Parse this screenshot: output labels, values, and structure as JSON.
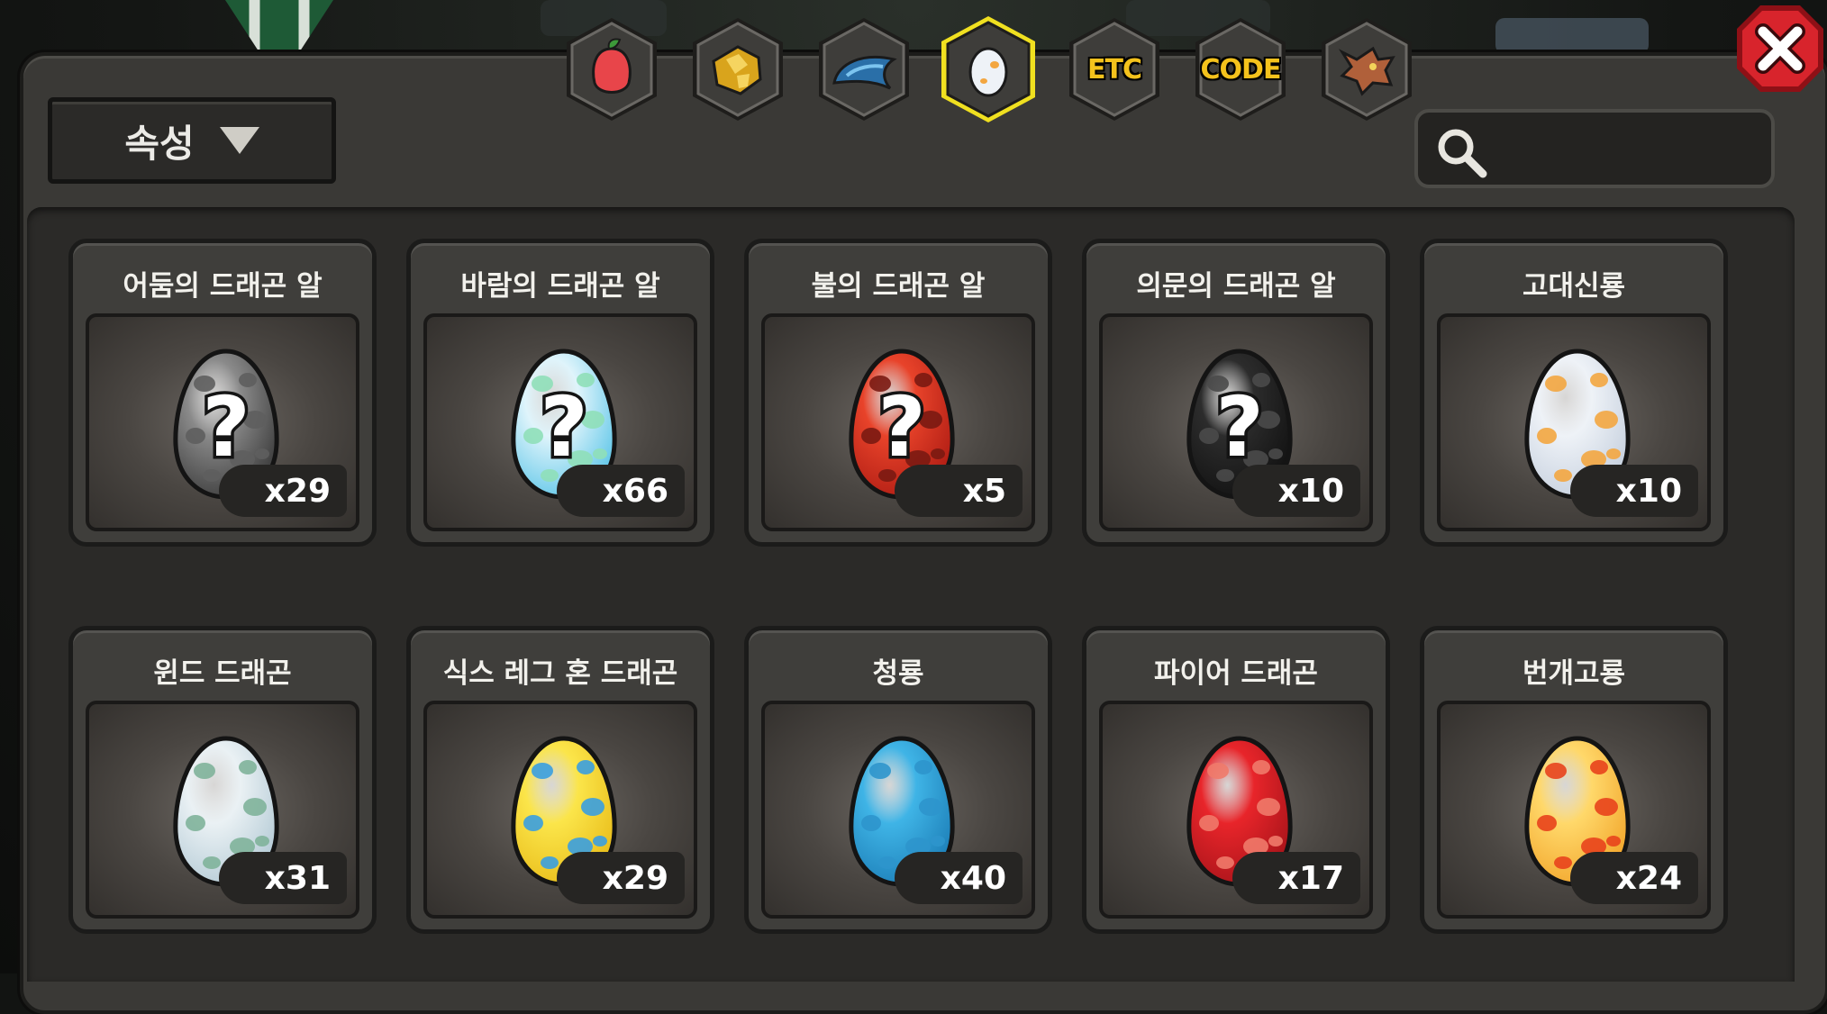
{
  "colors": {
    "panel": "#3a3936",
    "tab_selected_border": "#f0e020",
    "tab_text": "#f4c21c",
    "close_red": "#d8242c"
  },
  "filter": {
    "label": "속성"
  },
  "search": {
    "value": ""
  },
  "tabs": [
    {
      "icon": "fruit-icon",
      "selected": false
    },
    {
      "icon": "gold-ore-icon",
      "selected": false
    },
    {
      "icon": "dragon-scale-icon",
      "selected": false
    },
    {
      "icon": "egg-icon",
      "selected": true
    },
    {
      "label": "ETC",
      "selected": false
    },
    {
      "label": "CODE",
      "selected": false
    },
    {
      "icon": "dragon-head-icon",
      "selected": false
    }
  ],
  "items": [
    {
      "name": "어둠의 드래곤 알",
      "count": "x29",
      "egg": "mystery",
      "base": "#8a8a8a",
      "dark": "#3c3c3c",
      "spot": "#5e5e5e"
    },
    {
      "name": "바람의 드래곤 알",
      "count": "x66",
      "egg": "mystery",
      "base": "#dff4fb",
      "dark": "#5ec6e8",
      "spot": "#8fdfb8"
    },
    {
      "name": "불의 드래곤 알",
      "count": "x5",
      "egg": "mystery",
      "base": "#e8432a",
      "dark": "#b01d14",
      "spot": "#7a1a12"
    },
    {
      "name": "의문의 드래곤 알",
      "count": "x10",
      "egg": "mystery",
      "base": "#2c2c2c",
      "dark": "#121212",
      "spot": "#4a4a4a"
    },
    {
      "name": "고대신룡",
      "count": "x10",
      "egg": "plain",
      "base": "#eef2f7",
      "dark": "#c6d0de",
      "spot": "#f3a640"
    },
    {
      "name": "윈드 드래곤",
      "count": "x31",
      "egg": "plain",
      "base": "#eaf1f4",
      "dark": "#b5cbd6",
      "spot": "#7fb39a"
    },
    {
      "name": "식스 레그 혼 드래곤",
      "count": "x29",
      "egg": "plain",
      "base": "#fbe54a",
      "dark": "#e9bd1a",
      "spot": "#3a9ee0"
    },
    {
      "name": "청룡",
      "count": "x40",
      "egg": "plain",
      "base": "#3fb4e6",
      "dark": "#1d7fb8",
      "spot": "#2d95cc"
    },
    {
      "name": "파이어 드래곤",
      "count": "x17",
      "egg": "plain",
      "base": "#e8252a",
      "dark": "#a8141a",
      "spot": "#f07a6a"
    },
    {
      "name": "번개고룡",
      "count": "x24",
      "egg": "plain",
      "base": "#ffd86a",
      "dark": "#f2a62c",
      "spot": "#e8431c"
    }
  ]
}
